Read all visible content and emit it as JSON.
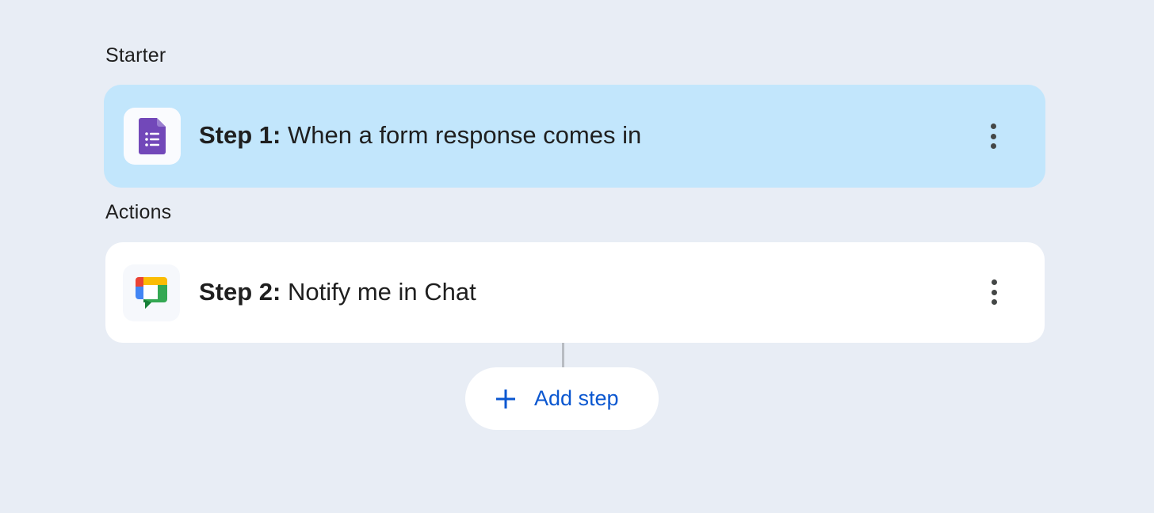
{
  "sections": {
    "starter_label": "Starter",
    "actions_label": "Actions"
  },
  "steps": [
    {
      "number_label": "Step 1:",
      "description": "When a form response comes in",
      "icon": "google-forms-icon",
      "selected": true
    },
    {
      "number_label": "Step 2:",
      "description": "Notify me in Chat",
      "icon": "google-chat-icon",
      "selected": false
    }
  ],
  "add_step": {
    "label": "Add step",
    "icon": "plus-icon"
  },
  "colors": {
    "background": "#e8edf5",
    "selected_card": "#c2e6fc",
    "card": "#ffffff",
    "accent": "#0b57d0",
    "forms_purple": "#7248b9"
  }
}
